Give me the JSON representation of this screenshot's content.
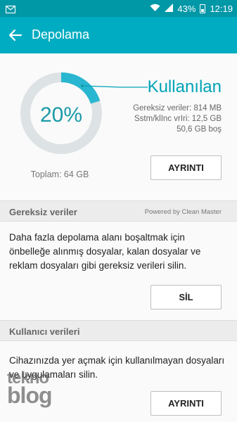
{
  "status_bar": {
    "battery": "43%",
    "time": "12:19"
  },
  "app_bar": {
    "title": "Depolama"
  },
  "storage": {
    "percent_label": "20%",
    "used_fraction": 0.2,
    "used_title": "Kullanılan",
    "stats": [
      "Gereksiz veriler: 814 MB",
      "Sstm/klInc vrIri: 12,5 GB",
      "50,6 GB boş"
    ],
    "total": "Toplam: 64 GB",
    "detail_button": "AYRINTI"
  },
  "junk": {
    "header": "Gereksiz veriler",
    "powered": "Powered by Clean Master",
    "description": "Daha fazla depolama alanı boşaltmak için önbelleğe alınmış dosyalar, kalan dosyalar ve reklam dosyaları gibi gereksiz verileri silin.",
    "button": "SİL"
  },
  "user": {
    "header": "Kullanıcı verileri",
    "description": "Cihazınızda yer açmak için kullanılmayan dosyaları ve uygulamaları silin.",
    "button": "AYRINTI"
  },
  "watermark": {
    "top": "tekno",
    "bottom": "blog"
  },
  "colors": {
    "accent": "#00acc1",
    "status_bar": "#0097a7",
    "ring_used": "#29b6d0",
    "ring_free": "#dde2e4"
  },
  "icons": [
    "mail-icon",
    "wifi-icon",
    "signal-icon",
    "battery-icon",
    "back-arrow-icon"
  ]
}
